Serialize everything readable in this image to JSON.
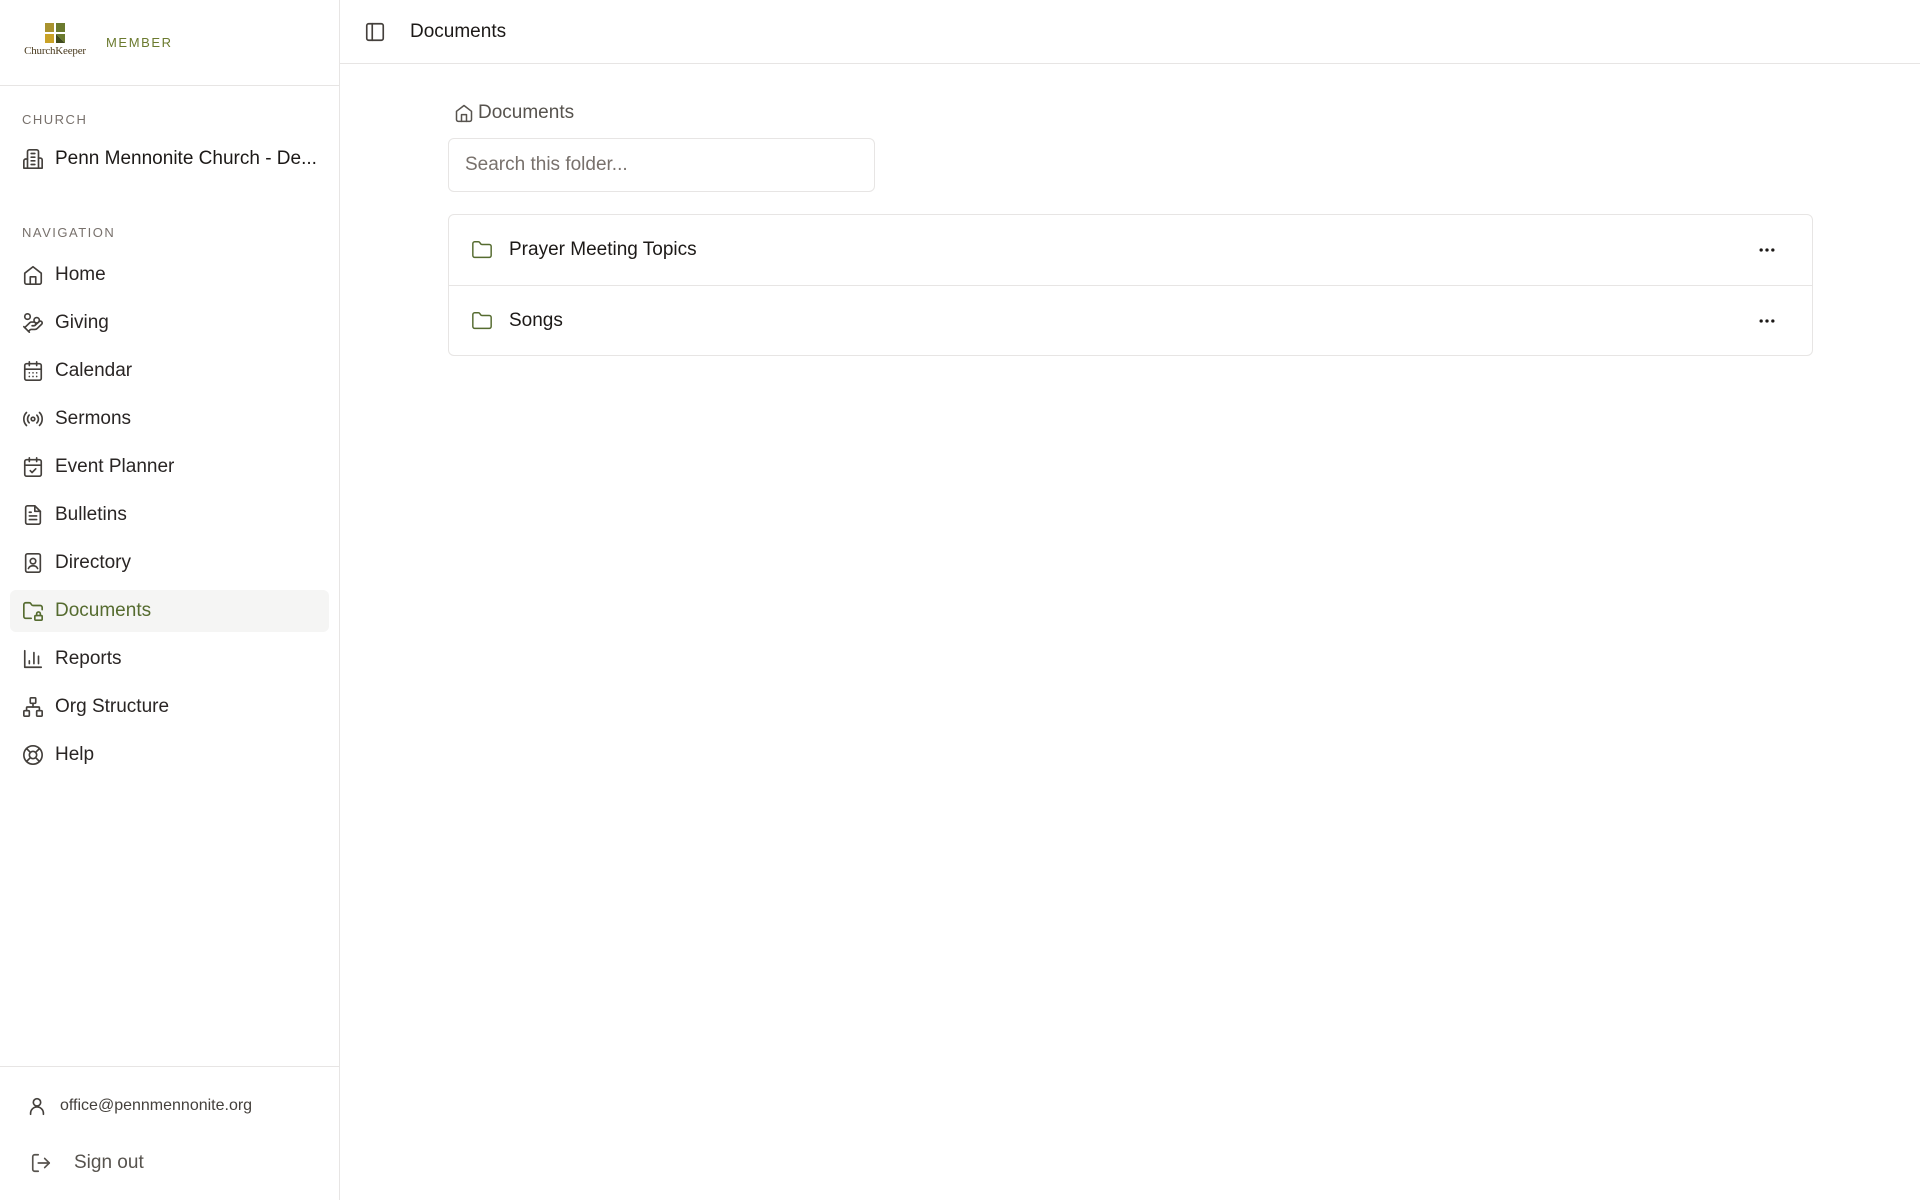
{
  "brand": {
    "logo_text": "ChurchKeeper",
    "role": "MEMBER"
  },
  "church": {
    "section_label": "CHURCH",
    "name": "Penn Mennonite Church - De..."
  },
  "navigation": {
    "section_label": "NAVIGATION",
    "items": [
      {
        "label": "Home",
        "icon": "home-icon",
        "active": false
      },
      {
        "label": "Giving",
        "icon": "hand-coins-icon",
        "active": false
      },
      {
        "label": "Calendar",
        "icon": "calendar-icon",
        "active": false
      },
      {
        "label": "Sermons",
        "icon": "radio-icon",
        "active": false
      },
      {
        "label": "Event Planner",
        "icon": "calendar-check-icon",
        "active": false
      },
      {
        "label": "Bulletins",
        "icon": "file-text-icon",
        "active": false
      },
      {
        "label": "Directory",
        "icon": "contact-book-icon",
        "active": false
      },
      {
        "label": "Documents",
        "icon": "folder-lock-icon",
        "active": true
      },
      {
        "label": "Reports",
        "icon": "bar-chart-icon",
        "active": false
      },
      {
        "label": "Org Structure",
        "icon": "network-icon",
        "active": false
      },
      {
        "label": "Help",
        "icon": "life-buoy-icon",
        "active": false
      }
    ]
  },
  "footer": {
    "user_email": "office@pennmennonite.org",
    "sign_out_label": "Sign out"
  },
  "topbar": {
    "title": "Documents"
  },
  "main": {
    "breadcrumb": "Documents",
    "search_placeholder": "Search this folder...",
    "folders": [
      {
        "name": "Prayer Meeting Topics"
      },
      {
        "name": "Songs"
      }
    ]
  },
  "colors": {
    "accent": "#556b2f",
    "active_bg": "#f5f5f4",
    "border": "#e7e5e4",
    "muted_text": "#78716c"
  }
}
